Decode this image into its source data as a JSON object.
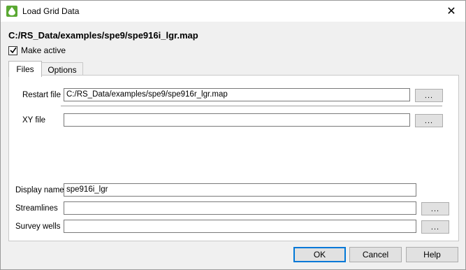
{
  "window": {
    "title": "Load Grid Data"
  },
  "file_path": "C:/RS_Data/examples/spe9/spe916i_lgr.map",
  "make_active": {
    "label": "Make active",
    "checked": true
  },
  "tabs": [
    {
      "label": "Files",
      "active": true
    },
    {
      "label": "Options",
      "active": false
    }
  ],
  "fields": {
    "restart_file": {
      "label": "Restart file",
      "value": "C:/RS_Data/examples/spe9/spe916r_lgr.map",
      "browse_label": "..."
    },
    "xy_file": {
      "label": "XY file",
      "value": "",
      "browse_label": "..."
    },
    "display_name": {
      "label": "Display name",
      "value": "spe916i_lgr"
    },
    "streamlines": {
      "label": "Streamlines",
      "value": "",
      "browse_label": "..."
    },
    "survey_wells": {
      "label": "Survey wells",
      "value": "",
      "browse_label": "..."
    }
  },
  "buttons": {
    "ok": "OK",
    "cancel": "Cancel",
    "help": "Help"
  },
  "icons": {
    "app": "droplet-icon",
    "close": "close-icon",
    "check": "checkmark-icon"
  },
  "colors": {
    "app_icon": "#5aa832",
    "default_button_border": "#0078d7"
  }
}
